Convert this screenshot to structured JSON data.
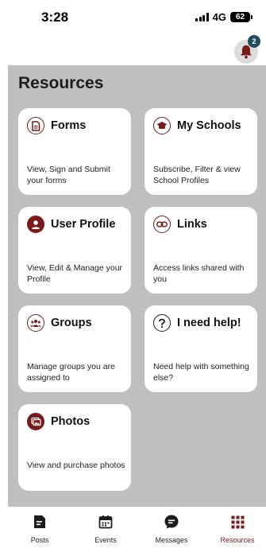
{
  "status_bar": {
    "time": "3:28",
    "network": "4G",
    "battery": "62"
  },
  "header": {
    "notification_count": "2"
  },
  "page": {
    "title": "Resources"
  },
  "cards": [
    {
      "title": "Forms",
      "description": "View, Sign and Submit your forms",
      "icon": "document-icon"
    },
    {
      "title": "My Schools",
      "description": "Subscribe, Filter & view School Profiles",
      "icon": "graduation-cap-icon"
    },
    {
      "title": "User Profile",
      "description": "View, Edit & Manage your Profile",
      "icon": "user-icon"
    },
    {
      "title": "Links",
      "description": "Access links shared with you",
      "icon": "link-icon"
    },
    {
      "title": "Groups",
      "description": "Manage groups you are assigned to",
      "icon": "group-icon"
    },
    {
      "title": "I need help!",
      "description": "Need help with something else?",
      "icon": "question-icon"
    },
    {
      "title": "Photos",
      "description": "View and purchase photos",
      "icon": "photos-icon"
    }
  ],
  "nav": [
    {
      "label": "Posts",
      "icon": "posts-icon"
    },
    {
      "label": "Events",
      "icon": "calendar-icon"
    },
    {
      "label": "Messages",
      "icon": "message-icon"
    },
    {
      "label": "Resources",
      "icon": "grid-icon",
      "active": true
    }
  ],
  "colors": {
    "accent": "#7a1a1a",
    "badge": "#1f4e5f",
    "background": "#bfbfbf"
  }
}
